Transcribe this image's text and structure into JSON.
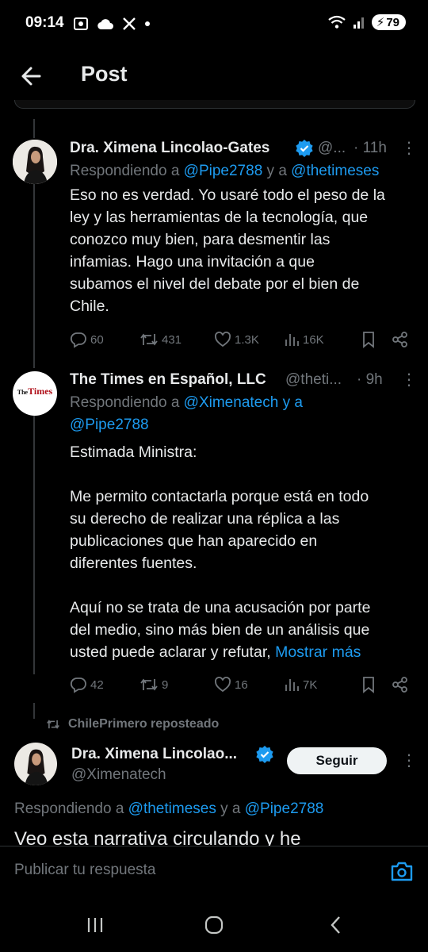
{
  "status_bar": {
    "time": "09:14",
    "battery": "79"
  },
  "header": {
    "title": "Post"
  },
  "tweets": [
    {
      "name": "Dra. Ximena Lincolao-Gates",
      "handle": "@...",
      "time": "· 11h",
      "replying_prefix": "Respondiendo a ",
      "replying_mention1": "@Pipe2788",
      "replying_mid": " y a ",
      "replying_mention2": "@thetimeses",
      "text": "Eso no es verdad. Yo usaré todo el peso de la\nley y las herramientas de la tecnología, que\nconozco muy bien, para desmentir  las\ninfamias.  Hago una invitación a que\nsubamos el nivel del debate por el bien de\nChile.",
      "replies": "60",
      "reposts": "431",
      "likes": "1.3K",
      "views": "16K"
    },
    {
      "name": "The Times en Español, LLC",
      "handle": "@theti...",
      "time": "· 9h",
      "logo_word": "Times",
      "logo_prefix": "The",
      "replying_prefix": "Respondiendo a ",
      "replying_mention1": "@Ximenatech",
      "replying_mid": " y a",
      "replying_mention2": "@Pipe2788",
      "text": "Estimada Ministra:\n\nMe permito contactarla porque está en todo\nsu derecho de realizar una réplica a las\npublicaciones que han aparecido en\ndiferentes fuentes.\n\nAquí no se trata de una acusación por parte\ndel medio, sino más bien de un análisis que\nusted puede aclarar y refutar, ",
      "show_more": "Mostrar más",
      "replies": "42",
      "reposts": "9",
      "likes": "16",
      "views": "7K"
    }
  ],
  "reposted": {
    "label": "ChilePrimero reposteado",
    "name": "Dra. Ximena Lincolao...",
    "handle": "@Ximenatech",
    "follow_label": "Seguir",
    "replying_prefix": "Respondiendo a ",
    "replying_mention1": "@thetimeses",
    "replying_mid": " y a ",
    "replying_mention2": "@Pipe2788",
    "text_partial": "Veo esta narrativa circulando y he"
  },
  "reply_bar": {
    "placeholder": "Publicar tu respuesta"
  },
  "colors": {
    "accent": "#1d9bf0",
    "muted": "#71767b",
    "text": "#e7e9ea",
    "background": "#000000"
  }
}
